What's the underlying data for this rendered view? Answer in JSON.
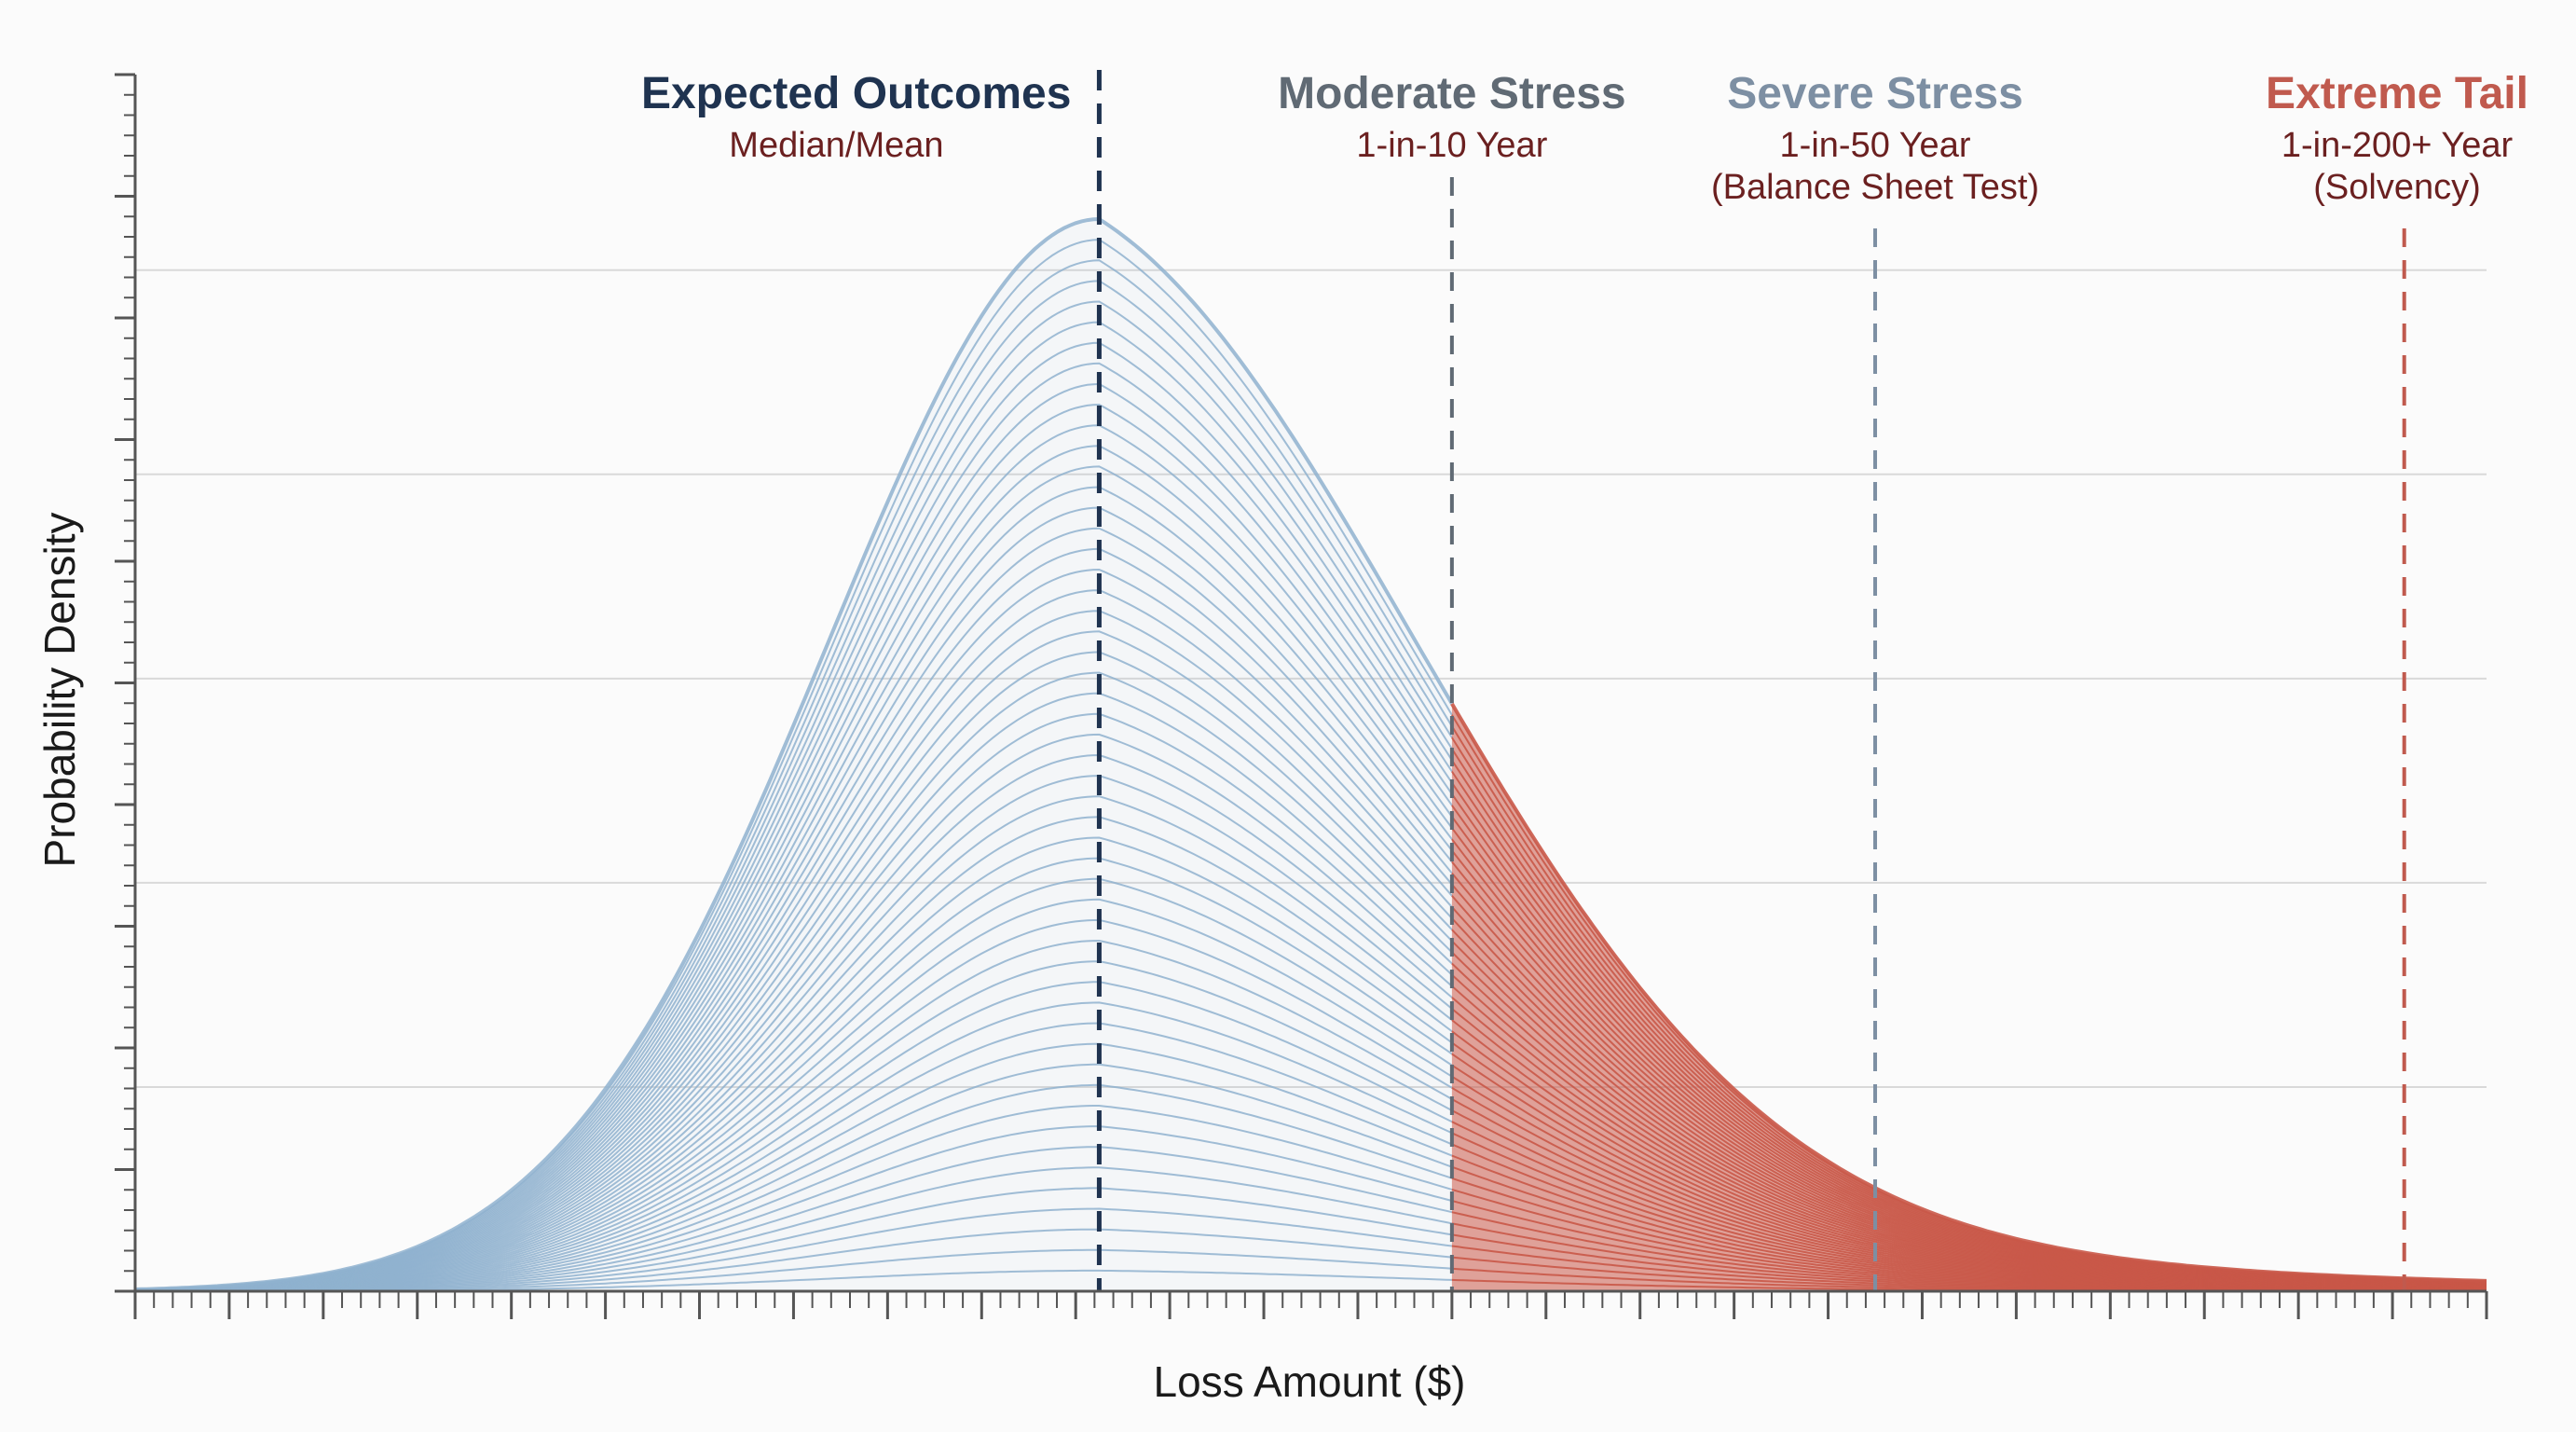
{
  "chart_data": {
    "type": "area",
    "title": "",
    "xlabel": "Loss Amount ($)",
    "ylabel": "Probability Density",
    "xlim": [
      0,
      100
    ],
    "ylim": [
      0,
      1.05
    ],
    "grid": true,
    "grid_lines_y": [
      0.2,
      0.4,
      0.6,
      0.8,
      1.0
    ],
    "distribution": {
      "description_x": "loss",
      "mode_x": 41,
      "peak_density": 1.05,
      "left_spread": 11.5,
      "right_spread": 14.5,
      "tail_half_life": 12.5,
      "series": [
        {
          "name": "",
          "x_from": 0,
          "x_to": 56,
          "color": "#8fb2cf"
        },
        {
          "name": "",
          "x_from": 56,
          "x_to": 100,
          "color": "#c95848"
        }
      ]
    },
    "markers": [
      {
        "x": 41,
        "title": "Expected Outcomes",
        "subtitle": [
          "Median/Mean"
        ],
        "color": "#1f3350",
        "dash": "22,14",
        "from_top": true
      },
      {
        "x": 56,
        "title": "Moderate Stress",
        "subtitle": [
          "1-in-10 Year"
        ],
        "color": "#606a74",
        "dash": "20,14",
        "from_top": false
      },
      {
        "x": 74,
        "title": "Severe Stress",
        "subtitle": [
          "1-in-50 Year",
          "(Balance Sheet Test)"
        ],
        "color": "#7d8fa3",
        "dash": "20,14",
        "from_top": false
      },
      {
        "x": 96.5,
        "title": "Extreme Tail",
        "subtitle": [
          "1-in-200+ Year",
          "(Solvency)"
        ],
        "color": "#c05a4e",
        "dash": "20,14",
        "from_top": false
      }
    ],
    "colors": {
      "body": "#8fb2cf",
      "tail": "#c95848",
      "grid": "#d9d9d9",
      "axis": "#555555"
    }
  }
}
